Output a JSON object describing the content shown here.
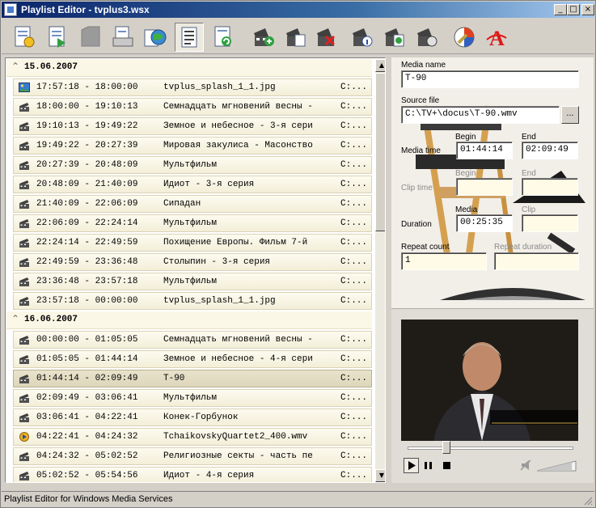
{
  "window": {
    "title": "Playlist Editor - tvplus3.wsx"
  },
  "toolbar": {
    "icons": [
      "new-playlist-icon",
      "open-playlist-icon",
      "save-disabled-icon",
      "print-icon",
      "publish-icon",
      "properties-icon",
      "refresh-icon",
      "add-media-icon",
      "copy-media-icon",
      "delete-media-icon",
      "media-info-icon",
      "media-refresh-icon",
      "media-settings-icon",
      "tools-icon",
      "font-icon"
    ]
  },
  "playlist": {
    "groups": [
      {
        "date": "15.06.2007",
        "items": [
          {
            "time": "17:57:18 - 18:00:00",
            "name": "tvplus_splash_1_1.jpg",
            "path": "C:...",
            "type": "image"
          },
          {
            "time": "18:00:00 - 19:10:13",
            "name": "Семнадцать мгновений весны -",
            "path": "C:...",
            "type": "video"
          },
          {
            "time": "19:10:13 - 19:49:22",
            "name": "Земное и небесное - 3-я сери",
            "path": "C:...",
            "type": "video"
          },
          {
            "time": "19:49:22 - 20:27:39",
            "name": "Мировая закулиса - Масонство",
            "path": "C:...",
            "type": "video"
          },
          {
            "time": "20:27:39 - 20:48:09",
            "name": "Мультфильм",
            "path": "C:...",
            "type": "video"
          },
          {
            "time": "20:48:09 - 21:40:09",
            "name": "Идиот - 3-я серия",
            "path": "C:...",
            "type": "video"
          },
          {
            "time": "21:40:09 - 22:06:09",
            "name": "Сипадан",
            "path": "C:...",
            "type": "video"
          },
          {
            "time": "22:06:09 - 22:24:14",
            "name": "Мультфильм",
            "path": "C:...",
            "type": "video"
          },
          {
            "time": "22:24:14 - 22:49:59",
            "name": "Похищение Европы. Фильм 7-й",
            "path": "C:...",
            "type": "video"
          },
          {
            "time": "22:49:59 - 23:36:48",
            "name": "Столыпин  - 3-я серия",
            "path": "C:...",
            "type": "video"
          },
          {
            "time": "23:36:48 - 23:57:18",
            "name": "Мультфильм",
            "path": "C:...",
            "type": "video"
          },
          {
            "time": "23:57:18 - 00:00:00",
            "name": "tvplus_splash_1_1.jpg",
            "path": "C:...",
            "type": "video"
          }
        ]
      },
      {
        "date": "16.06.2007",
        "items": [
          {
            "time": "00:00:00 - 01:05:05",
            "name": "Семнадцать мгновений весны -",
            "path": "C:...",
            "type": "video"
          },
          {
            "time": "01:05:05 - 01:44:14",
            "name": "Земное и небесное - 4-я сери",
            "path": "C:...",
            "type": "video"
          },
          {
            "time": "01:44:14 - 02:09:49",
            "name": "Т-90",
            "path": "C:...",
            "type": "video",
            "selected": true
          },
          {
            "time": "02:09:49 - 03:06:41",
            "name": "Мультфильм",
            "path": "C:...",
            "type": "video"
          },
          {
            "time": "03:06:41 - 04:22:41",
            "name": "Конек-Горбунок",
            "path": "C:...",
            "type": "video"
          },
          {
            "time": "04:22:41 - 04:24:32",
            "name": "TchaikovskyQuartet2_400.wmv",
            "path": "C:...",
            "type": "wmv"
          },
          {
            "time": "04:24:32 - 05:02:52",
            "name": "Религиозные секты - часть пе",
            "path": "C:...",
            "type": "video"
          },
          {
            "time": "05:02:52 - 05:54:56",
            "name": "Идиот - 4-я серия",
            "path": "C:...",
            "type": "video"
          }
        ]
      }
    ]
  },
  "details": {
    "media_name_label": "Media name",
    "media_name": "T-90",
    "source_file_label": "Source file",
    "source_file": "C:\\TV+\\docus\\T-90.wmv",
    "browse_label": "...",
    "begin_label": "Begin",
    "end_label": "End",
    "media_time_label": "Media time",
    "media_begin": "01:44:14",
    "media_end": "02:09:49",
    "clip_begin_label": "Begin",
    "clip_end_label": "End",
    "clip_time_label": "Clip time",
    "clip_begin": "",
    "clip_end": "",
    "duration_media_label": "Media",
    "duration_clip_label": "Clip",
    "duration_label": "Duration",
    "duration_media": "00:25:35",
    "duration_clip": "",
    "repeat_count_label": "Repeat count",
    "repeat_count": "1",
    "repeat_duration_label": "Repeat duration",
    "repeat_duration": ""
  },
  "player": {
    "seek_fraction": 0.22,
    "volume_fraction": 0.9
  },
  "statusbar": {
    "text": "Playlist Editor for Windows Media Services"
  }
}
